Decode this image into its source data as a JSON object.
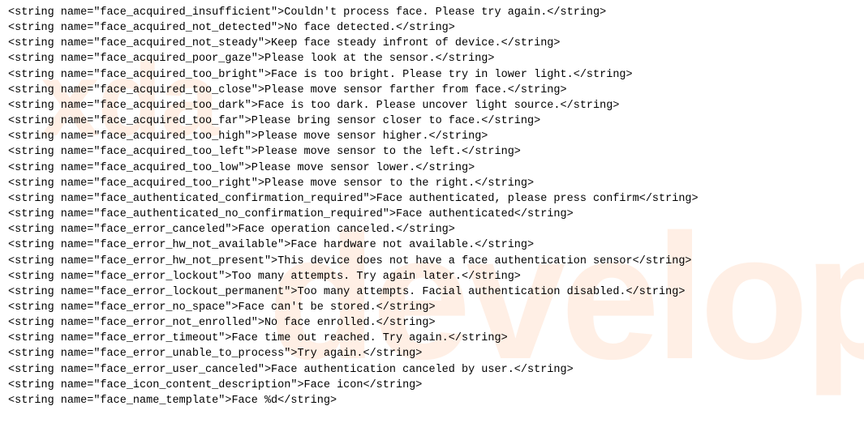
{
  "watermark": {
    "text1": "xda",
    "text2": "developers"
  },
  "strings": [
    {
      "name": "face_acquired_insufficient",
      "value": "Couldn't process face. Please try again."
    },
    {
      "name": "face_acquired_not_detected",
      "value": "No face detected."
    },
    {
      "name": "face_acquired_not_steady",
      "value": "Keep face steady infront of device."
    },
    {
      "name": "face_acquired_poor_gaze",
      "value": "Please look at the sensor."
    },
    {
      "name": "face_acquired_too_bright",
      "value": "Face is too bright. Please try in lower light."
    },
    {
      "name": "face_acquired_too_close",
      "value": "Please move sensor farther from face."
    },
    {
      "name": "face_acquired_too_dark",
      "value": "Face is too dark. Please uncover light source."
    },
    {
      "name": "face_acquired_too_far",
      "value": "Please bring sensor closer to face."
    },
    {
      "name": "face_acquired_too_high",
      "value": "Please move sensor higher."
    },
    {
      "name": "face_acquired_too_left",
      "value": "Please move sensor to the left."
    },
    {
      "name": "face_acquired_too_low",
      "value": "Please move sensor lower."
    },
    {
      "name": "face_acquired_too_right",
      "value": "Please move sensor to the right."
    },
    {
      "name": "face_authenticated_confirmation_required",
      "value": "Face authenticated, please press confirm"
    },
    {
      "name": "face_authenticated_no_confirmation_required",
      "value": "Face authenticated"
    },
    {
      "name": "face_error_canceled",
      "value": "Face operation canceled."
    },
    {
      "name": "face_error_hw_not_available",
      "value": "Face hardware not available."
    },
    {
      "name": "face_error_hw_not_present",
      "value": "This device does not have a face authentication sensor"
    },
    {
      "name": "face_error_lockout",
      "value": "Too many attempts. Try again later."
    },
    {
      "name": "face_error_lockout_permanent",
      "value": "Too many attempts. Facial authentication disabled."
    },
    {
      "name": "face_error_no_space",
      "value": "Face can't be stored."
    },
    {
      "name": "face_error_not_enrolled",
      "value": "No face enrolled."
    },
    {
      "name": "face_error_timeout",
      "value": "Face time out reached. Try again."
    },
    {
      "name": "face_error_unable_to_process",
      "value": "Try again."
    },
    {
      "name": "face_error_user_canceled",
      "value": "Face authentication canceled by user."
    },
    {
      "name": "face_icon_content_description",
      "value": "Face icon"
    },
    {
      "name": "face_name_template",
      "value": "Face %d"
    }
  ]
}
